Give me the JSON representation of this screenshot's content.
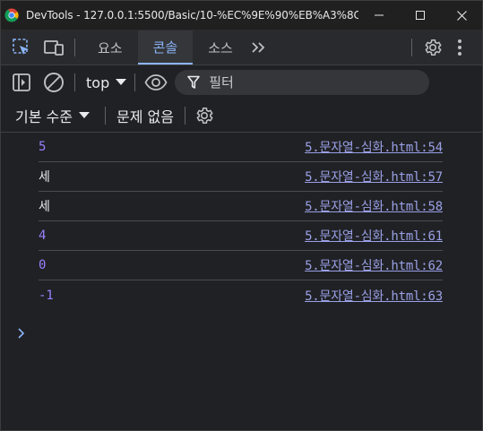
{
  "window": {
    "title": "DevTools - 127.0.0.1:5500/Basic/10-%EC%9E%90%EB%A3%8C%ED..."
  },
  "tabs": [
    {
      "label": "요소"
    },
    {
      "label": "콘솔"
    },
    {
      "label": "소스"
    }
  ],
  "toolbar": {
    "context": "top",
    "filter_placeholder": "필터"
  },
  "toolbar2": {
    "levels_label": "기본 수준",
    "issues_label": "문제 없음"
  },
  "console": {
    "messages": [
      {
        "value": "5",
        "type": "number",
        "source": "5.문자열-심화.html:54"
      },
      {
        "value": "세",
        "type": "string",
        "source": "5.문자열-심화.html:57"
      },
      {
        "value": "세",
        "type": "string",
        "source": "5.문자열-심화.html:58"
      },
      {
        "value": "4",
        "type": "number",
        "source": "5.문자열-심화.html:61"
      },
      {
        "value": "0",
        "type": "number",
        "source": "5.문자열-심화.html:62"
      },
      {
        "value": "-1",
        "type": "number",
        "source": "5.문자열-심화.html:63"
      }
    ]
  },
  "colors": {
    "accent": "#8ab4f8",
    "number": "#9980ff",
    "link": "#9aa0e6",
    "background": "#202124"
  }
}
